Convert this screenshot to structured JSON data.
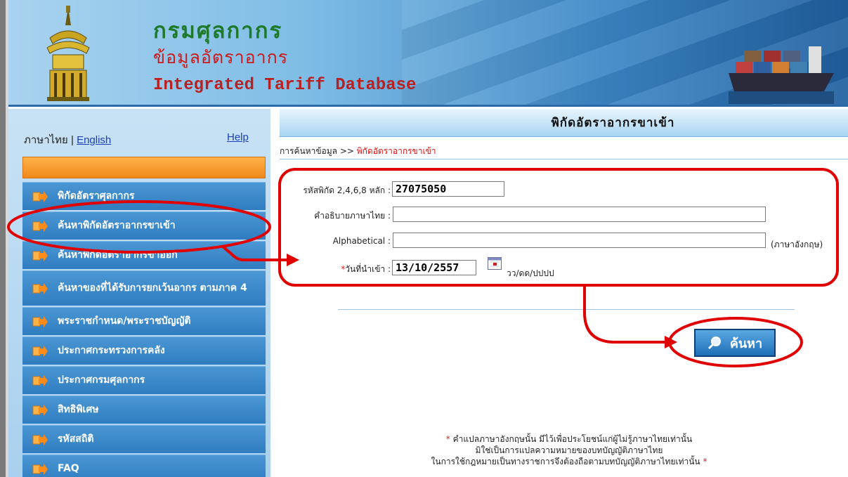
{
  "header": {
    "title_th": "กรมศุลกากร",
    "subtitle_th": "ข้อมูลอัตราอากร",
    "subtitle_en": "Integrated Tariff Database"
  },
  "sidebar": {
    "lang_th": "ภาษาไทย",
    "lang_sep": " | ",
    "lang_en": "English",
    "help": "Help",
    "items": [
      {
        "label": "พิกัดอัตราศุลกากร"
      },
      {
        "label": "ค้นหาพิกัดอัตราอากรขาเข้า"
      },
      {
        "label": "ค้นหาพิกัดอัตราอากรขาออก"
      },
      {
        "label": "ค้นหาของที่ได้รับการยกเว้นอากร ตามภาค 4"
      },
      {
        "label": "พระราชกำหนด/พระราชบัญญัติ"
      },
      {
        "label": "ประกาศกระทรวงการคลัง"
      },
      {
        "label": "ประกาศกรมศุลกากร"
      },
      {
        "label": "สิทธิพิเศษ"
      },
      {
        "label": "รหัสสถิติ"
      },
      {
        "label": "FAQ"
      }
    ]
  },
  "main": {
    "title": "พิกัดอัตราอากรขาเข้า",
    "breadcrumb_root": "การค้นหาข้อมูล >> ",
    "breadcrumb_current": "พิกัดอัตราอากรขาเข้า"
  },
  "form": {
    "code_label": "รหัสพิกัด 2,4,6,8 หลัก :",
    "code_value": "27075050",
    "desc_th_label": "คำอธิบายภาษาไทย :",
    "desc_th_value": "",
    "alpha_label": "Alphabetical :",
    "alpha_value": "",
    "alpha_unit": "(ภาษาอังกฤษ)",
    "req_mark": "*",
    "date_label": "วันที่นำเข้า :",
    "date_value": "13/10/2557",
    "date_format": "วว/ดด/ปปปป"
  },
  "search_button": "ค้นหา",
  "note": {
    "line1": "คำแปลภาษาอังกฤษนั้น มีไว้เพื่อประโยชน์แก่ผู้ไม่รู้ภาษาไทยเท่านั้น",
    "line2": "มิใช่เป็นการแปลความหมายของบทบัญญัติภาษาไทย",
    "line3": "ในการใช้กฎหมายเป็นทางราชการจึงต้องถือตามบทบัญญัติภาษาไทยเท่านั้น"
  },
  "colors": {
    "annotation": "#e00000",
    "menu_blue": "#2f7cc0",
    "orange_bar": "#f08a1a"
  }
}
